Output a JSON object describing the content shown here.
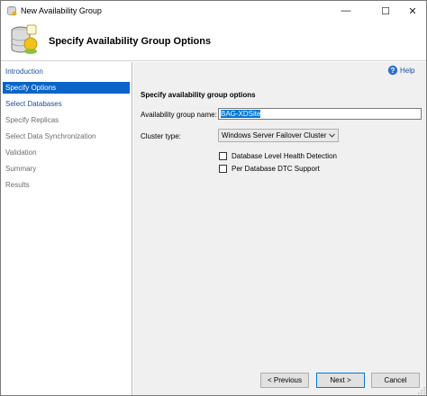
{
  "window": {
    "title": "New Availability Group",
    "minimize_glyph": "—",
    "maximize_glyph": "☐",
    "close_glyph": "✕"
  },
  "header": {
    "title": "Specify Availability Group Options",
    "icon": "database-wizard-icon"
  },
  "sidebar": {
    "items": [
      {
        "label": "Introduction",
        "state": "link"
      },
      {
        "label": "Specify Options",
        "state": "selected"
      },
      {
        "label": "Select Databases",
        "state": "link"
      },
      {
        "label": "Specify Replicas",
        "state": "disabled"
      },
      {
        "label": "Select Data Synchronization",
        "state": "disabled"
      },
      {
        "label": "Validation",
        "state": "disabled"
      },
      {
        "label": "Summary",
        "state": "disabled"
      },
      {
        "label": "Results",
        "state": "disabled"
      }
    ]
  },
  "main": {
    "help_label": "Help",
    "section_title": "Specify availability group options",
    "group_name_label": "Availability group name:",
    "group_name_value": "BAG-XDSite",
    "cluster_type_label": "Cluster type:",
    "cluster_type_value": "Windows Server Failover Cluster",
    "checkbox_health": "Database Level Health Detection",
    "checkbox_dtc": "Per Database DTC Support"
  },
  "footer": {
    "previous_label": "< Previous",
    "next_label": "Next >",
    "cancel_label": "Cancel"
  },
  "colors": {
    "selected_nav": "#0a64c8",
    "link": "#1a4f9e",
    "panel_bg": "#f0f0f0"
  }
}
